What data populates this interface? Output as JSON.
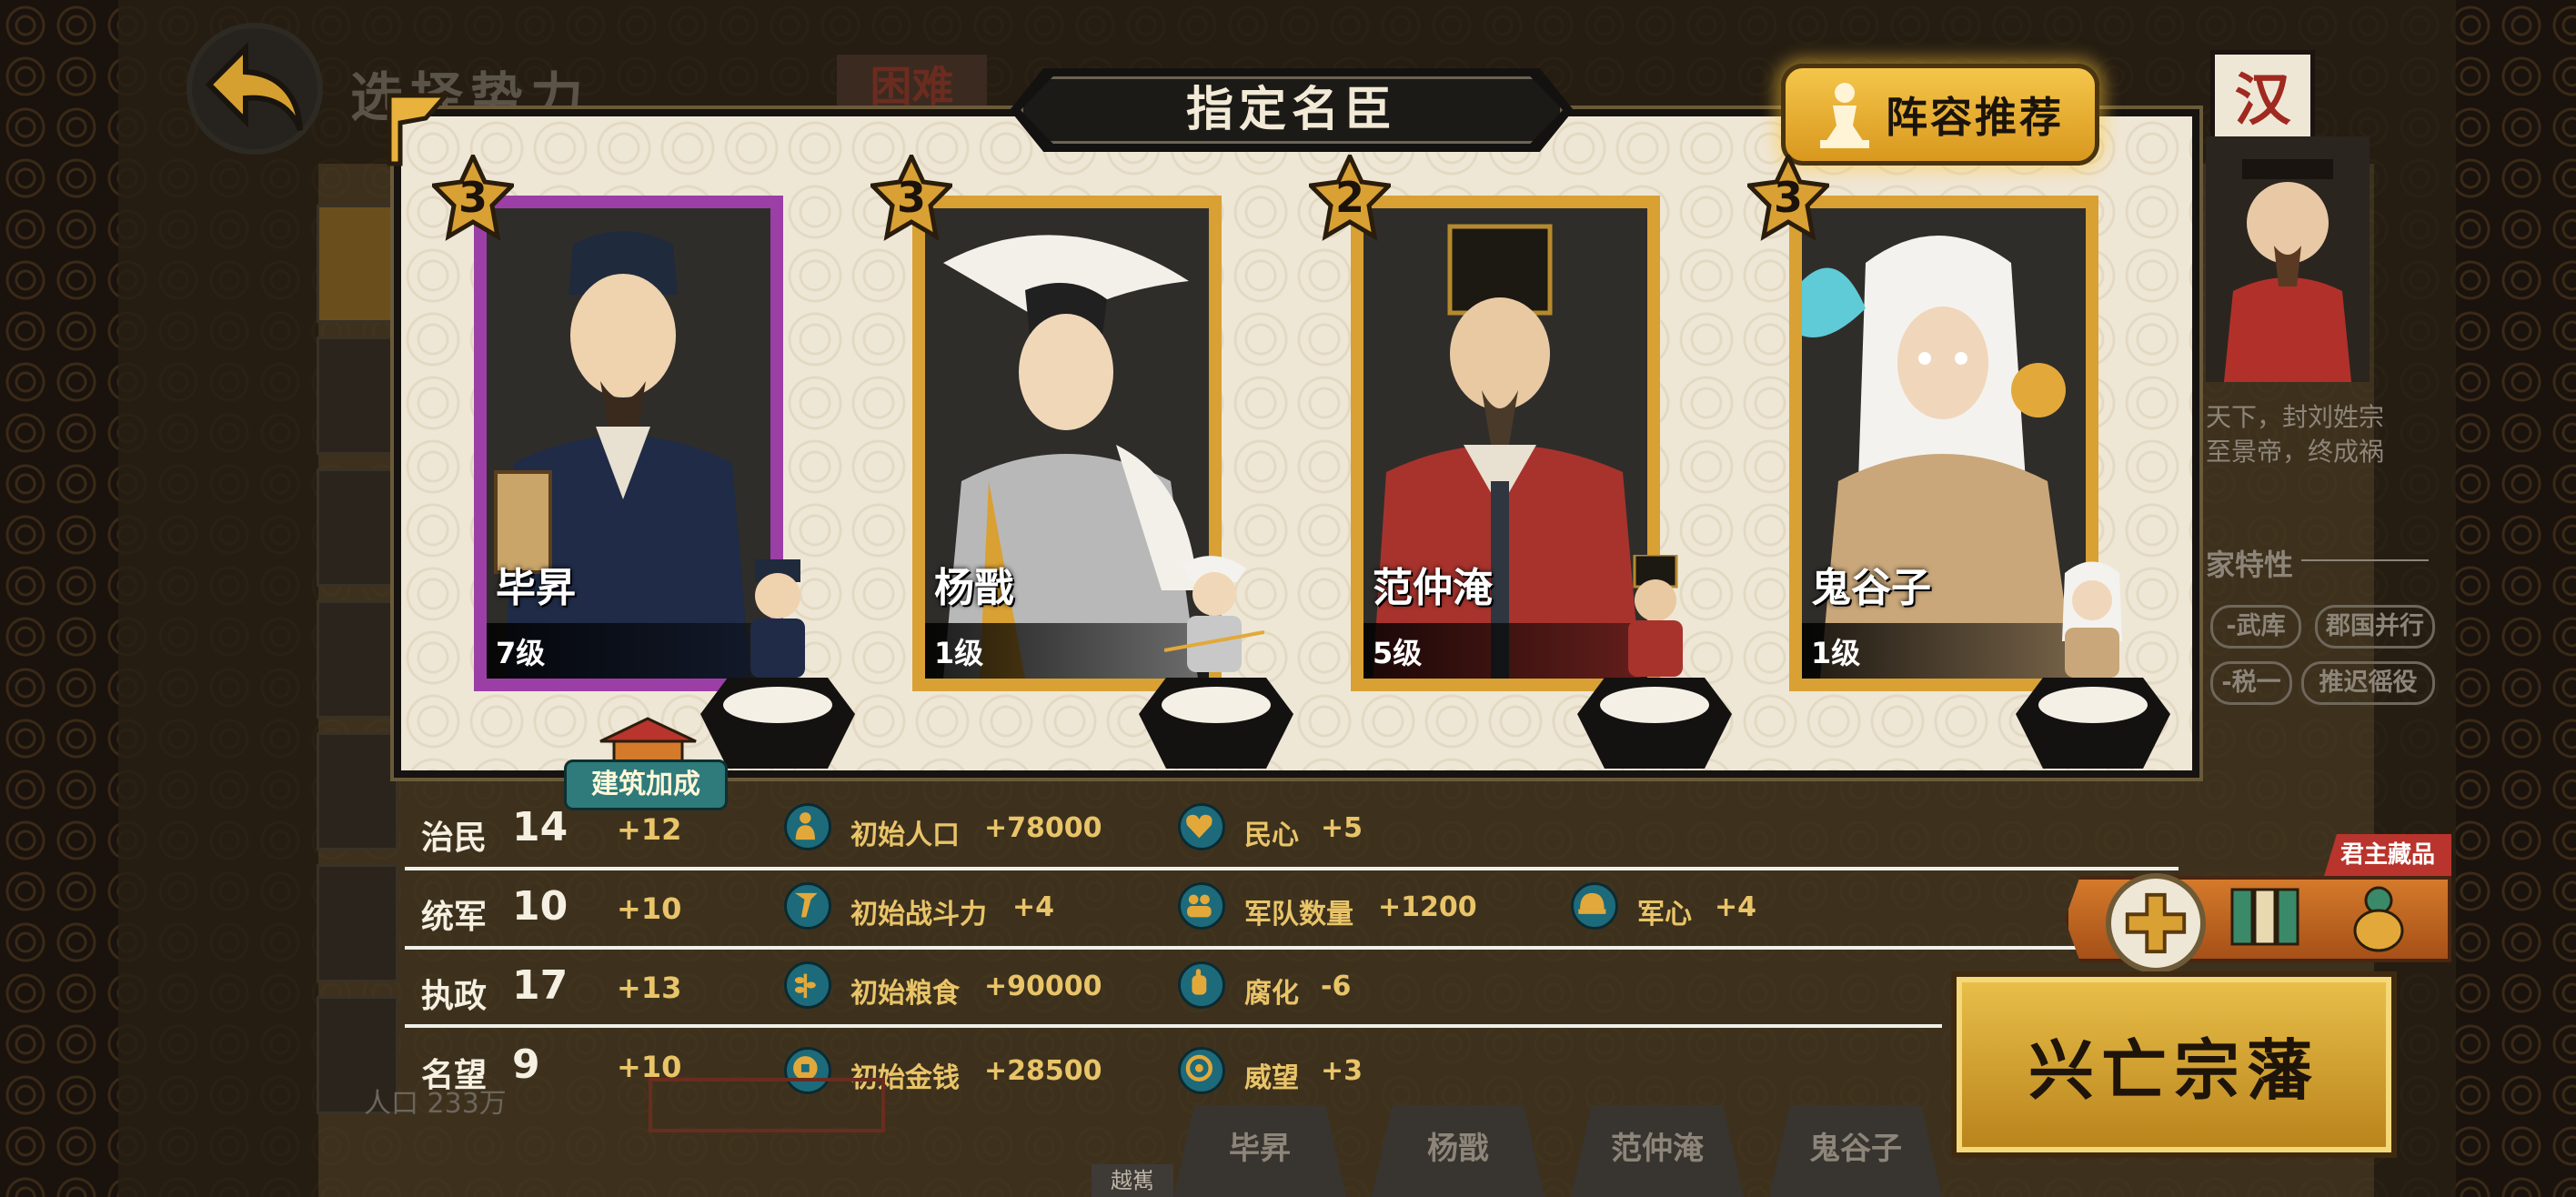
{
  "header": {
    "bg_title": "选择势力",
    "difficulty": "困难",
    "panel_title": "指定名臣",
    "recommend_label": "阵容推荐"
  },
  "ministers": [
    {
      "name": "毕昇",
      "level": "7级",
      "stars": "3",
      "frame_color": "#9b3fa6"
    },
    {
      "name": "杨戬",
      "level": "1级",
      "stars": "3",
      "frame_color": "#d9a033"
    },
    {
      "name": "范仲淹",
      "level": "5级",
      "stars": "2",
      "frame_color": "#d9a033"
    },
    {
      "name": "鬼谷子",
      "level": "1级",
      "stars": "3",
      "frame_color": "#d9a033"
    }
  ],
  "building_bonus": "建筑加成",
  "stats": [
    {
      "label": "治民",
      "value": "14",
      "bonus": "+12",
      "effects": [
        {
          "icon": "population-icon",
          "text": "初始人口",
          "value": "+78000"
        },
        {
          "icon": "heart-icon",
          "text": "民心",
          "value": "+5"
        }
      ]
    },
    {
      "label": "统军",
      "value": "10",
      "bonus": "+10",
      "effects": [
        {
          "icon": "weapon-icon",
          "text": "初始战斗力",
          "value": "+4"
        },
        {
          "icon": "troops-icon",
          "text": "军队数量",
          "value": "+1200"
        },
        {
          "icon": "helmet-icon",
          "text": "军心",
          "value": "+4"
        }
      ]
    },
    {
      "label": "执政",
      "value": "17",
      "bonus": "+13",
      "effects": [
        {
          "icon": "grain-icon",
          "text": "初始粮食",
          "value": "+90000"
        },
        {
          "icon": "hand-icon",
          "text": "腐化",
          "value": "-6"
        }
      ]
    },
    {
      "label": "名望",
      "value": "9",
      "bonus": "+10",
      "effects": [
        {
          "icon": "coin-icon",
          "text": "初始金钱",
          "value": "+28500"
        },
        {
          "icon": "prestige-icon",
          "text": "威望",
          "value": "+3"
        }
      ]
    }
  ],
  "ruler": {
    "flag": "汉",
    "desc_line1": "天下，封刘姓宗",
    "desc_line2": "至景帝，终成祸",
    "traits_title": "家特性",
    "traits": [
      "-武库",
      "郡国并行",
      "-税一",
      "推迟徭役"
    ]
  },
  "collection": {
    "tag": "君主藏品"
  },
  "start_button": "兴亡宗藩",
  "bottom_tabs": [
    "毕昇",
    "杨戬",
    "范仲淹",
    "鬼谷子"
  ],
  "bottom_region": "越嶲",
  "left_count": "人口 233万",
  "colors": {
    "gold": "#e9c468",
    "panel": "#efe7d6",
    "accent": "#d9a033",
    "purple": "#9b3fa6"
  }
}
